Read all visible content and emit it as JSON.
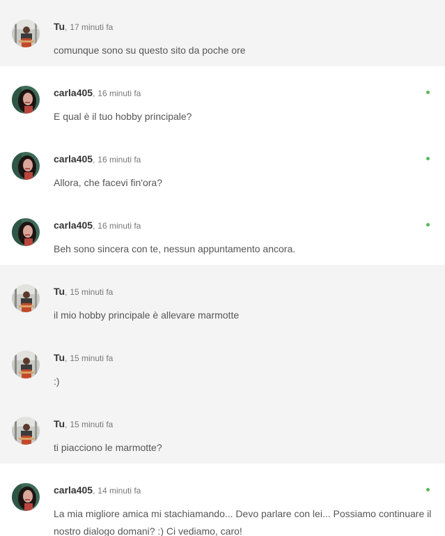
{
  "colors": {
    "self_bg": "#f4f4f4",
    "other_bg": "#ffffff",
    "online": "#5cb85c"
  },
  "separator": ",",
  "messages": [
    {
      "author": "Tu",
      "time": "17 minuti fa",
      "text": "comunque sono su questo sito da poche ore",
      "self": true,
      "online": false
    },
    {
      "author": "carla405",
      "time": "16 minuti fa",
      "text": "E qual è il tuo hobby principale?",
      "self": false,
      "online": true
    },
    {
      "author": "carla405",
      "time": "16 minuti fa",
      "text": "Allora, che facevi fin'ora?",
      "self": false,
      "online": true
    },
    {
      "author": "carla405",
      "time": "16 minuti fa",
      "text": "Beh sono sincera con te, nessun appuntamento ancora.",
      "self": false,
      "online": true
    },
    {
      "author": "Tu",
      "time": "15 minuti fa",
      "text": "il mio hobby principale è allevare marmotte",
      "self": true,
      "online": false
    },
    {
      "author": "Tu",
      "time": "15 minuti fa",
      "text": ":)",
      "self": true,
      "online": false
    },
    {
      "author": "Tu",
      "time": "15 minuti fa",
      "text": "ti piacciono le marmotte?",
      "self": true,
      "online": false
    },
    {
      "author": "carla405",
      "time": "14 minuti fa",
      "text": "La mia migliore amica mi stachiamando... Devo parlare con lei... Possiamo continuare il nostro dialogo domani? :) Ci vediamo, caro!",
      "self": false,
      "online": true
    }
  ]
}
